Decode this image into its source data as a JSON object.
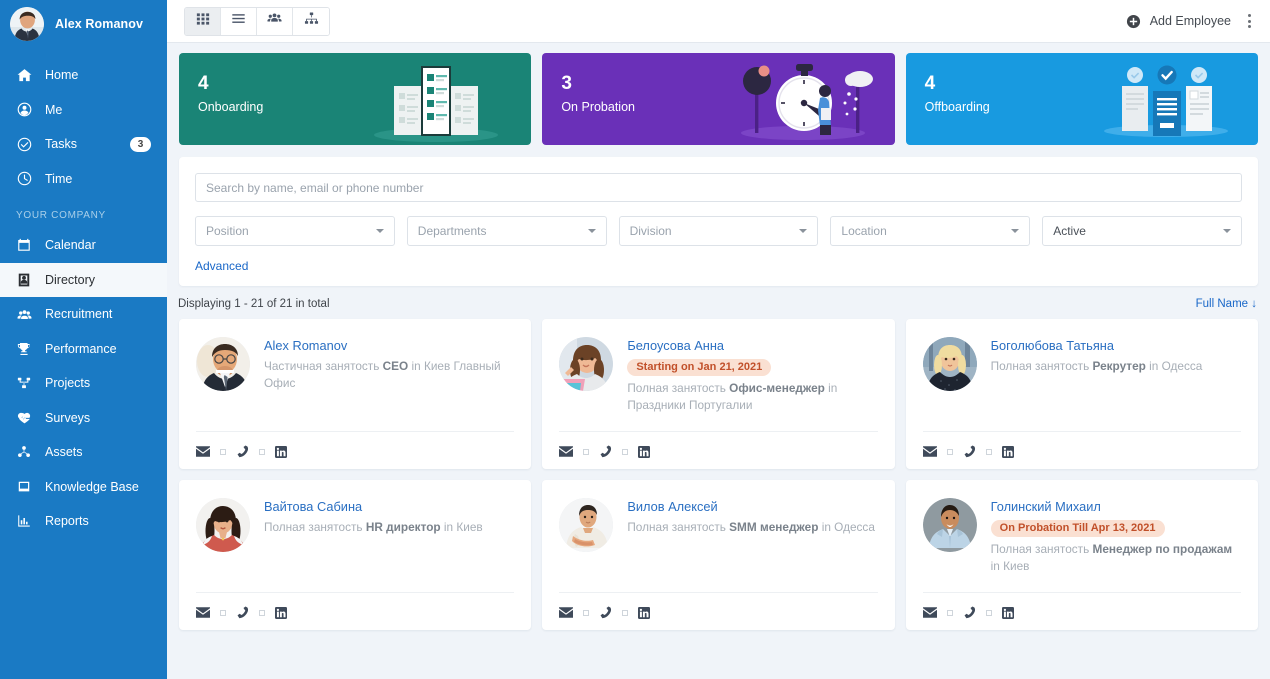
{
  "sidebar": {
    "user": {
      "name": "Alex Romanov",
      "avatar": "user-avatar-alex"
    },
    "items": [
      {
        "label": "Home",
        "icon": "home-icon",
        "badge": null,
        "active": false
      },
      {
        "label": "Me",
        "icon": "user-circle-icon",
        "badge": null,
        "active": false
      },
      {
        "label": "Tasks",
        "icon": "check-circle-icon",
        "badge": "3",
        "active": false
      },
      {
        "label": "Time",
        "icon": "clock-icon",
        "badge": null,
        "active": false
      }
    ],
    "section_label": "YOUR COMPANY",
    "company_items": [
      {
        "label": "Calendar",
        "icon": "calendar-icon",
        "active": false
      },
      {
        "label": "Directory",
        "icon": "contact-card-icon",
        "active": true
      },
      {
        "label": "Recruitment",
        "icon": "users-icon",
        "active": false
      },
      {
        "label": "Performance",
        "icon": "trophy-icon",
        "active": false
      },
      {
        "label": "Projects",
        "icon": "sitemap-icon",
        "active": false
      },
      {
        "label": "Surveys",
        "icon": "heart-pulse-icon",
        "active": false
      },
      {
        "label": "Assets",
        "icon": "assets-icon",
        "active": false
      },
      {
        "label": "Knowledge Base",
        "icon": "book-icon",
        "active": false
      },
      {
        "label": "Reports",
        "icon": "bar-chart-icon",
        "active": false
      }
    ],
    "colors": {
      "background": "#1a7ac4",
      "active_background": "#f4f8fb",
      "section_text": "#a9cfe9"
    }
  },
  "topbar": {
    "views": [
      {
        "name": "grid-view",
        "icon": "grid-icon",
        "active": true
      },
      {
        "name": "list-view",
        "icon": "list-icon",
        "active": false
      },
      {
        "name": "team-view",
        "icon": "people-icon",
        "active": false
      },
      {
        "name": "org-chart-view",
        "icon": "org-chart-icon",
        "active": false
      }
    ],
    "add_employee_label": "Add Employee",
    "add_employee_icon": "plus-circle-icon",
    "more_menu_icon": "vertical-dots-icon"
  },
  "stats": [
    {
      "count": "4",
      "label": "Onboarding",
      "color": "#1a8476",
      "art": "documents-illustration"
    },
    {
      "count": "3",
      "label": "On Probation",
      "color": "#6a30b8",
      "art": "stopwatch-illustration"
    },
    {
      "count": "4",
      "label": "Offboarding",
      "color": "#189ae0",
      "art": "checklist-illustration"
    }
  ],
  "filters": {
    "search_placeholder": "Search by name, email or phone number",
    "search_value": "",
    "dropdowns": [
      {
        "name": "position",
        "label": "Position",
        "selected": false
      },
      {
        "name": "departments",
        "label": "Departments",
        "selected": false
      },
      {
        "name": "division",
        "label": "Division",
        "selected": false
      },
      {
        "name": "location",
        "label": "Location",
        "selected": false
      },
      {
        "name": "status",
        "label": "Active",
        "selected": true
      }
    ],
    "advanced_label": "Advanced"
  },
  "results": {
    "count_text": "Displaying 1 - 21 of 21 in total",
    "sort_label": "Full Name",
    "sort_direction": "↓"
  },
  "employees": [
    {
      "name": "Alex Romanov",
      "badge": null,
      "employment": "Частичная занятость",
      "position": "CEO",
      "in_word": "in",
      "location": "Киев Главный Офис",
      "avatar": "photo-alex-romanov"
    },
    {
      "name": "Белоусова Анна",
      "badge": "Starting on Jan 21, 2021",
      "employment": "Полная занятость",
      "position": "Офис-менеджер",
      "in_word": "in",
      "location": "Праздники Португалии",
      "avatar": "photo-belousova-anna"
    },
    {
      "name": "Боголюбова Татьяна",
      "badge": null,
      "employment": "Полная занятость",
      "position": "Рекрутер",
      "in_word": "in",
      "location": "Одесса",
      "avatar": "photo-bogolyubova-tatyana"
    },
    {
      "name": "Вайтова Сабина",
      "badge": null,
      "employment": "Полная занятость",
      "position": "HR директор",
      "in_word": "in",
      "location": "Киев",
      "avatar": "photo-vaytova-sabina"
    },
    {
      "name": "Вилов Алексей",
      "badge": null,
      "employment": "Полная занятость",
      "position": "SMM менеджер",
      "in_word": "in",
      "location": "Одесса",
      "avatar": "photo-vilov-aleksey"
    },
    {
      "name": "Голинский Михаил",
      "badge": "On Probation Till Apr 13, 2021",
      "employment": "Полная занятость",
      "position": "Менеджер по продажам",
      "in_word": "in",
      "location": "Киев",
      "avatar": "photo-golinskiy-mihail"
    }
  ],
  "contact_icons": [
    "email-icon",
    "phone-icon",
    "linkedin-icon"
  ],
  "badge_colors": {
    "background": "#fae0d2",
    "text": "#c1502a"
  }
}
